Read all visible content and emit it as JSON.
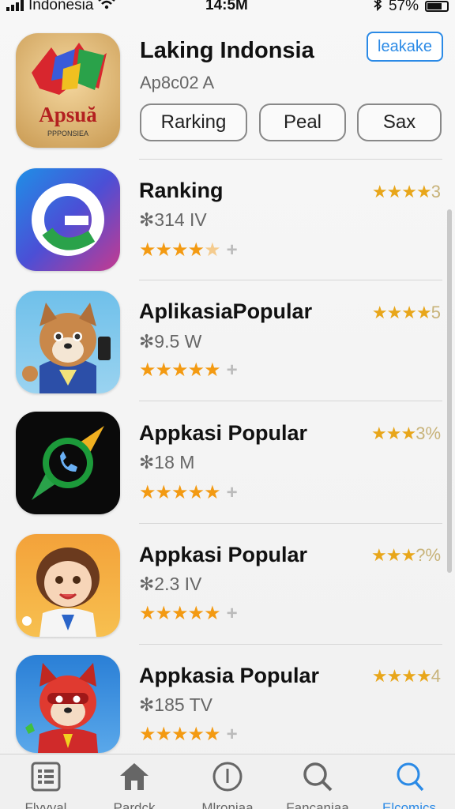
{
  "status_bar": {
    "carrier": "Indonesia",
    "time": "14:5M",
    "battery": "57%"
  },
  "header_app": {
    "title": "Laking Indonsia",
    "subtitle": "Ap8c02 A",
    "get_button": "leakake",
    "icon_text": "Apsuă",
    "icon_subtext": "PPPONSIEA",
    "pills": [
      "Rarking",
      "Peal",
      "Sax"
    ]
  },
  "apps": [
    {
      "title": "Ranking",
      "meta": "✻314 IV",
      "stars": "★★★★",
      "half": "★",
      "plus": "+",
      "rating_stars": "★★★★",
      "rating_num": "3"
    },
    {
      "title": "AplikasiaPopular",
      "meta": "✻9.5 W",
      "stars": "★★★★★",
      "half": "",
      "plus": "+",
      "rating_stars": "★★★★",
      "rating_num": "5"
    },
    {
      "title": "Appkasi Popular",
      "meta": "✻18 M",
      "stars": "★★★★★",
      "half": "",
      "plus": "+",
      "rating_stars": "★★★",
      "rating_num": "3%"
    },
    {
      "title": "Appkasi Popular",
      "meta": "✻2.3 IV",
      "stars": "★★★★★",
      "half": "",
      "plus": "+",
      "rating_stars": "★★★",
      "rating_num": "?%"
    },
    {
      "title": "Appkasia Popular",
      "meta": "✻185 TV",
      "stars": "★★★★★",
      "half": "",
      "plus": "+",
      "rating_stars": "★★★★",
      "rating_num": "4"
    }
  ],
  "tabs": [
    {
      "label": "Flyvyal",
      "icon": "grid-icon",
      "active": false
    },
    {
      "label": "Pardck",
      "icon": "home-icon",
      "active": false
    },
    {
      "label": "Mlronjaa",
      "icon": "clock-icon",
      "active": false
    },
    {
      "label": "Fancaniaa",
      "icon": "search-icon",
      "active": false
    },
    {
      "label": "Elcomics",
      "icon": "search-icon",
      "active": true
    }
  ],
  "colors": {
    "accent": "#2b8ae6",
    "star": "#f39a12"
  }
}
